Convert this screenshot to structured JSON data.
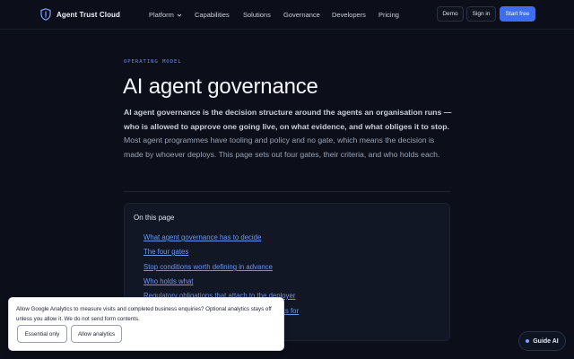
{
  "header": {
    "brand": "Agent Trust Cloud",
    "nav": [
      {
        "label": "Platform",
        "has_dropdown": true
      },
      {
        "label": "Capabilities"
      },
      {
        "label": "Solutions"
      },
      {
        "label": "Governance"
      },
      {
        "label": "Developers"
      },
      {
        "label": "Pricing"
      }
    ],
    "demo_label": "Demo",
    "signin_label": "Sign in",
    "start_label": "Start free"
  },
  "main": {
    "eyebrow": "OPERATING MODEL",
    "title": "AI agent governance",
    "intro_lead": "AI agent governance is the decision structure around the agents an organisation runs — who is allowed to approve one going live, on what evidence, and what obliges it to stop.",
    "intro_rest": " Most agent programmes have tooling and policy and no gate, which means the decision is made by whoever deploys. This page sets out four gates, their criteria, and who holds each."
  },
  "toc": {
    "title": "On this page",
    "links": [
      "What agent governance has to decide",
      "The four gates",
      "Stop conditions worth defining in advance",
      "Who holds what",
      "Regulatory obligations that attach to the deployer",
      "ks for"
    ]
  },
  "cookie": {
    "text": "Allow Google Analytics to measure visits and completed business enquiries? Optional analytics stays off unless you allow it. We do not send form contents.",
    "essential_label": "Essential only",
    "analytics_label": "Allow analytics"
  },
  "guide": {
    "label": "Guide AI"
  },
  "colors": {
    "background": "#0c0f19",
    "accent": "#3d6df0",
    "link": "#6c95f0"
  }
}
